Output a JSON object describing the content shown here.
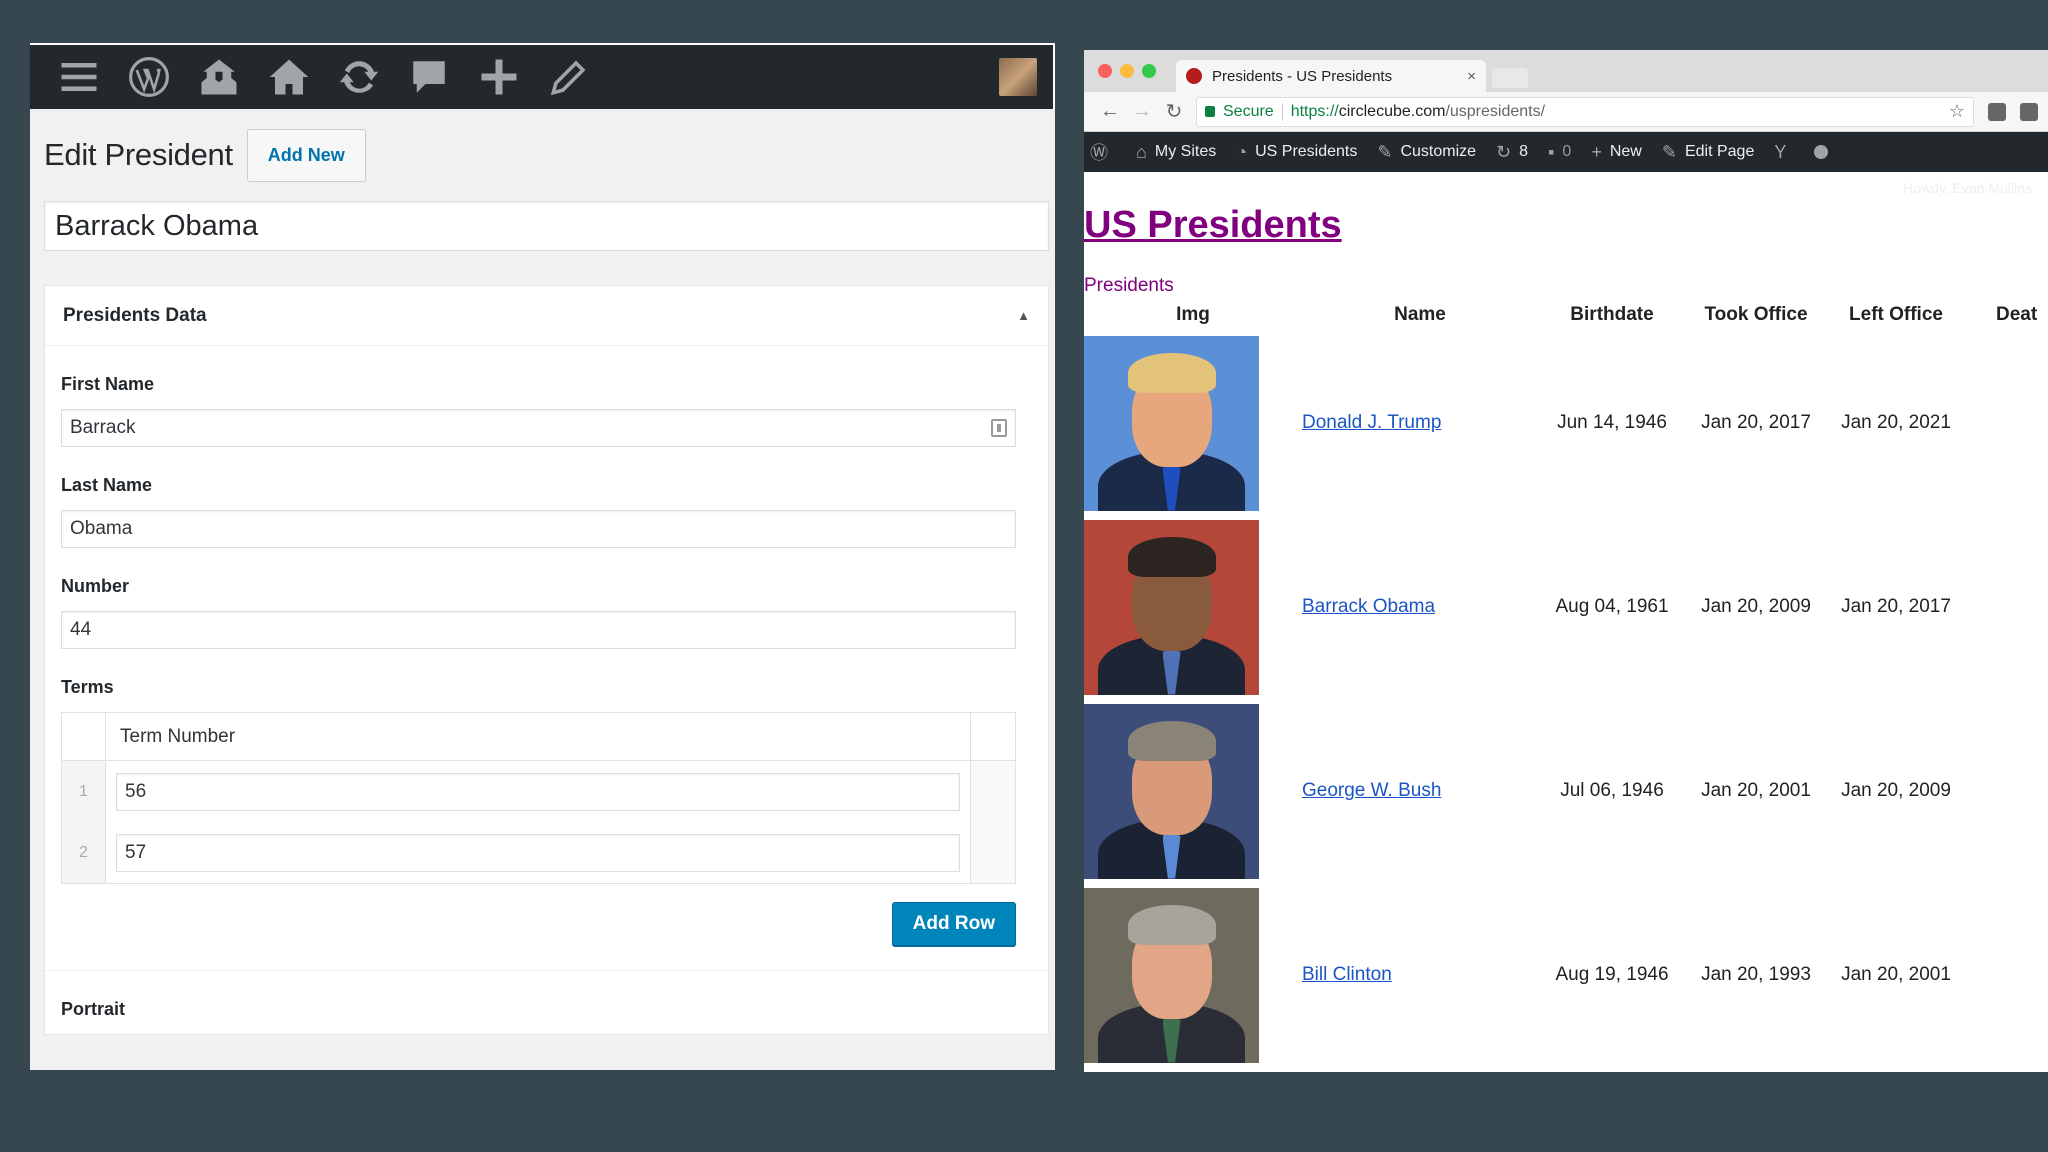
{
  "wp_admin": {
    "admin_bar_icons": [
      "menu-icon",
      "wordpress-icon",
      "my-sites-icon",
      "home-icon",
      "updates-icon",
      "comments-icon",
      "new-content-icon",
      "edit-icon"
    ],
    "page_title": "Edit President",
    "add_new_label": "Add New",
    "post_title": "Barrack Obama",
    "metabox": {
      "title": "Presidents Data",
      "first_name": {
        "label": "First Name",
        "value": "Barrack"
      },
      "last_name": {
        "label": "Last Name",
        "value": "Obama"
      },
      "number": {
        "label": "Number",
        "value": "44"
      },
      "terms": {
        "label": "Terms",
        "column": "Term Number",
        "rows": [
          {
            "order": "1",
            "value": "56"
          },
          {
            "order": "2",
            "value": "57"
          }
        ],
        "add_row_label": "Add Row"
      },
      "portrait_label": "Portrait"
    }
  },
  "browser": {
    "tab_title": "Presidents - US Presidents",
    "tab_close": "×",
    "secure_label": "Secure",
    "url_scheme": "https://",
    "url_host": "circlecube.com",
    "url_path": "/uspresidents/",
    "admin_bar": {
      "my_sites": "My Sites",
      "site_name": "US Presidents",
      "customize": "Customize",
      "updates_count": "8",
      "comments_count": "0",
      "new_label": "New",
      "edit_page": "Edit Page"
    },
    "howdy": "Howdy, Evan Mullins",
    "site_title": "US Presidents",
    "table_caption": "Presidents",
    "table_headers": {
      "img": "Img",
      "name": "Name",
      "birthdate": "Birthdate",
      "took_office": "Took Office",
      "left_office": "Left Office",
      "death": "Deat"
    },
    "presidents": [
      {
        "name": "Donald J. Trump",
        "birthdate": "Jun 14, 1946",
        "took_office": "Jan 20, 2017",
        "left_office": "Jan 20, 2021",
        "bg": "#5b8fd6",
        "skin": "#e8a67c",
        "hair": "#e3c27a",
        "suit": "#1c2a4a",
        "tie": "#1f4fbf"
      },
      {
        "name": "Barrack Obama",
        "birthdate": "Aug 04, 1961",
        "took_office": "Jan 20, 2009",
        "left_office": "Jan 20, 2017",
        "bg": "#b5473a",
        "skin": "#8a5a3c",
        "hair": "#2b2420",
        "suit": "#1d2433",
        "tie": "#4f72b8"
      },
      {
        "name": "George W. Bush",
        "birthdate": "Jul 06, 1946",
        "took_office": "Jan 20, 2001",
        "left_office": "Jan 20, 2009",
        "bg": "#3b4d78",
        "skin": "#d99a7a",
        "hair": "#8a8378",
        "suit": "#1b2234",
        "tie": "#5a8ad6"
      },
      {
        "name": "Bill Clinton",
        "birthdate": "Aug 19, 1946",
        "took_office": "Jan 20, 1993",
        "left_office": "Jan 20, 2001",
        "bg": "#6f6a5e",
        "skin": "#e2a585",
        "hair": "#a8a49c",
        "suit": "#2a2d35",
        "tie": "#3e6f4e"
      }
    ]
  }
}
